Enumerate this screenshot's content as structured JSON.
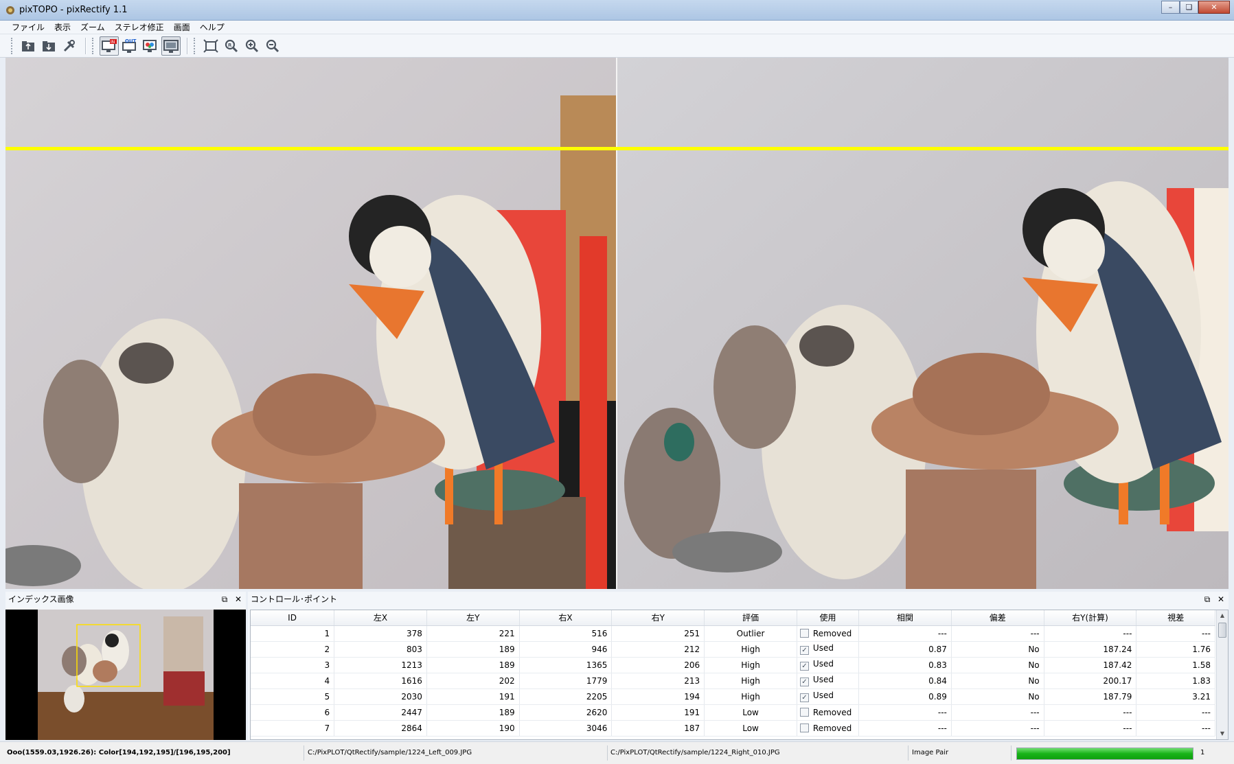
{
  "window": {
    "title": "pixTOPO - pixRectify 1.1"
  },
  "menu": [
    "ファイル",
    "表示",
    "ズーム",
    "ステレオ修正",
    "画面",
    "ヘルプ"
  ],
  "toolbar": {
    "groups": [
      [
        "open-folder-icon",
        "save-icon",
        "tools-icon"
      ],
      [
        "display-in-icon",
        "display-out-icon",
        "display-overlay-icon",
        "display-monitor-icon"
      ],
      [
        "fit-window-icon",
        "zoom-actual-icon",
        "zoom-in-icon",
        "zoom-out-icon"
      ]
    ]
  },
  "dock_index": {
    "title": "インデックス画像"
  },
  "dock_cp": {
    "title": "コントロール･ポイント",
    "columns": [
      "ID",
      "左X",
      "左Y",
      "右X",
      "右Y",
      "評価",
      "使用",
      "相関",
      "偏差",
      "右Y(計算)",
      "視差"
    ],
    "rows": [
      {
        "id": "1",
        "lx": "378",
        "ly": "221",
        "rx": "516",
        "ry": "251",
        "eval": "Outlier",
        "checked": false,
        "use": "Removed",
        "corr": "---",
        "dev": "---",
        "ry_calc": "---",
        "parallax": "---"
      },
      {
        "id": "2",
        "lx": "803",
        "ly": "189",
        "rx": "946",
        "ry": "212",
        "eval": "High",
        "checked": true,
        "use": "Used",
        "corr": "0.87",
        "dev": "No",
        "ry_calc": "187.24",
        "parallax": "1.76"
      },
      {
        "id": "3",
        "lx": "1213",
        "ly": "189",
        "rx": "1365",
        "ry": "206",
        "eval": "High",
        "checked": true,
        "use": "Used",
        "corr": "0.83",
        "dev": "No",
        "ry_calc": "187.42",
        "parallax": "1.58"
      },
      {
        "id": "4",
        "lx": "1616",
        "ly": "202",
        "rx": "1779",
        "ry": "213",
        "eval": "High",
        "checked": true,
        "use": "Used",
        "corr": "0.84",
        "dev": "No",
        "ry_calc": "200.17",
        "parallax": "1.83"
      },
      {
        "id": "5",
        "lx": "2030",
        "ly": "191",
        "rx": "2205",
        "ry": "194",
        "eval": "High",
        "checked": true,
        "use": "Used",
        "corr": "0.89",
        "dev": "No",
        "ry_calc": "187.79",
        "parallax": "3.21"
      },
      {
        "id": "6",
        "lx": "2447",
        "ly": "189",
        "rx": "2620",
        "ry": "191",
        "eval": "Low",
        "checked": false,
        "use": "Removed",
        "corr": "---",
        "dev": "---",
        "ry_calc": "---",
        "parallax": "---"
      },
      {
        "id": "7",
        "lx": "2864",
        "ly": "190",
        "rx": "3046",
        "ry": "187",
        "eval": "Low",
        "checked": false,
        "use": "Removed",
        "corr": "---",
        "dev": "---",
        "ry_calc": "---",
        "parallax": "---"
      }
    ]
  },
  "status": {
    "coords": "Ooo(1559.03,1926.26): Color[194,192,195]/[196,195,200]",
    "left_file": "C:/PixPLOT/QtRectify/sample/1224_Left_009.JPG",
    "right_file": "C:/PixPLOT/QtRectify/sample/1224_Right_010.JPG",
    "mode": "Image Pair",
    "progress": 1.0,
    "count": "1"
  },
  "colors": {
    "epipolar_line": "#ffff00",
    "progress": "#19b319"
  }
}
